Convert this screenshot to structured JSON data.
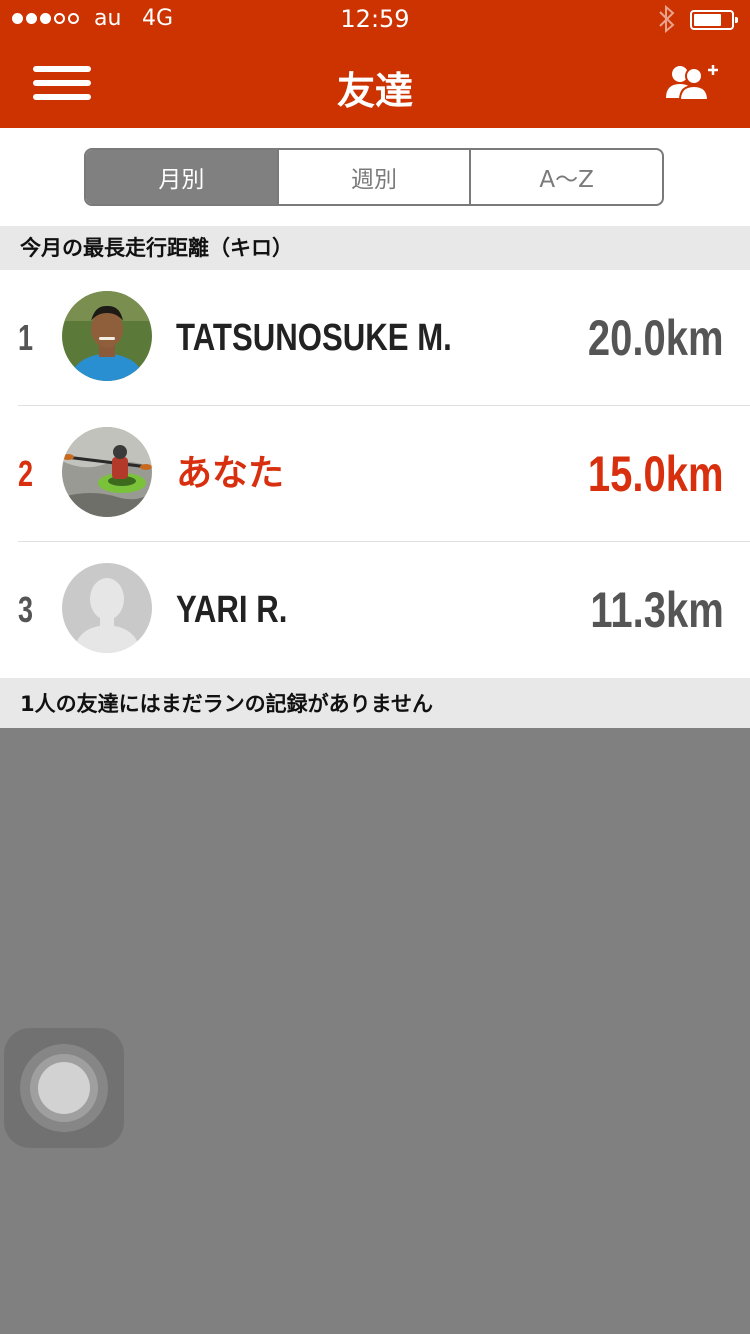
{
  "status_bar": {
    "carrier": "au",
    "network": "4G",
    "time": "12:59",
    "signal_bars_filled": 3,
    "signal_bars_total": 5,
    "battery_level": 0.75,
    "icons": [
      "signal-dots-icon",
      "bluetooth-icon",
      "battery-icon"
    ]
  },
  "nav": {
    "title": "友達",
    "left_icon": "hamburger-menu-icon",
    "right_icon": "add-friend-icon"
  },
  "segments": [
    {
      "label": "月別",
      "selected": true
    },
    {
      "label": "週別",
      "selected": false
    },
    {
      "label": "A〜Z",
      "selected": false
    }
  ],
  "section": {
    "title": "今月の最長走行距離（キロ）"
  },
  "leaderboard": [
    {
      "rank": "1",
      "name": "TATSUNOSUKE M.",
      "distance": "20.0km",
      "is_you": false,
      "avatar": "photo-avatar"
    },
    {
      "rank": "2",
      "name": "あなた",
      "distance": "15.0km",
      "is_you": true,
      "avatar": "kayak-photo-avatar"
    },
    {
      "rank": "3",
      "name": "YARI R.",
      "distance": "11.3km",
      "is_you": false,
      "avatar": "default-person-avatar"
    }
  ],
  "footer_note": "1人の友達にはまだランの記録がありません",
  "colors": {
    "brand": "#cc3300",
    "highlight": "#d8300f",
    "segment_active": "#808080",
    "section_bg": "#e8e8e8",
    "overlay": "#808080"
  },
  "assistive_touch_icon": "assistive-touch-icon"
}
